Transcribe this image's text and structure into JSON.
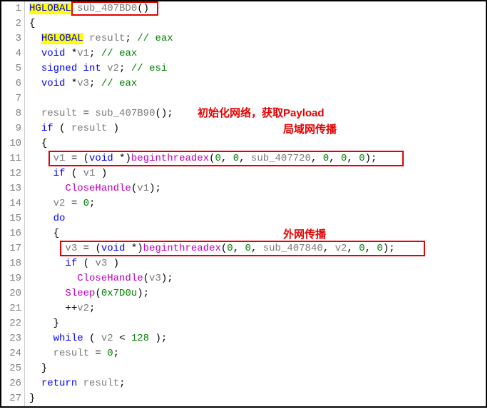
{
  "line_numbers": [
    "1",
    "2",
    "3",
    "4",
    "5",
    "6",
    "7",
    "8",
    "9",
    "10",
    "11",
    "12",
    "13",
    "14",
    "15",
    "16",
    "17",
    "18",
    "19",
    "20",
    "21",
    "22",
    "23",
    "24",
    "25",
    "26",
    "27"
  ],
  "code": {
    "l1": {
      "type": "HGLOBAL",
      "func": "sub_407BD0",
      "paren": "()"
    },
    "l2": "{",
    "l3": {
      "type": "HGLOBAL",
      "var": "result",
      "comment": "// eax"
    },
    "l4": {
      "type": "void",
      "ptr": "*",
      "var": "v1",
      "comment": "// eax"
    },
    "l5": {
      "type": "signed int",
      "var": "v2",
      "comment": "// esi"
    },
    "l6": {
      "type": "void",
      "ptr": "*",
      "var": "v3",
      "comment": "// eax"
    },
    "l8": {
      "var": "result",
      "func": "sub_407B90",
      "paren": "()"
    },
    "l9": {
      "kw": "if",
      "var": "result"
    },
    "l10": "{",
    "l11": {
      "var": "v1",
      "cast_kw": "void",
      "func": "beginthreadex",
      "args_pre": "(",
      "n0": "0",
      "n1": "0",
      "sub": "sub_407720",
      "n2": "0",
      "n3": "0",
      "n4": "0",
      "args_post": ");"
    },
    "l12": {
      "kw": "if",
      "var": "v1"
    },
    "l13": {
      "func": "CloseHandle",
      "var": "v1"
    },
    "l14": {
      "var": "v2",
      "val": "0"
    },
    "l15": {
      "kw": "do"
    },
    "l16": "{",
    "l17": {
      "var": "v3",
      "cast_kw": "void",
      "func": "beginthreadex",
      "n0": "0",
      "n1": "0",
      "sub": "sub_407840",
      "arg": "v2",
      "n3": "0",
      "n4": "0"
    },
    "l18": {
      "kw": "if",
      "var": "v3"
    },
    "l19": {
      "func": "CloseHandle",
      "var": "v3"
    },
    "l20": {
      "func": "Sleep",
      "val": "0x7D0u"
    },
    "l21": {
      "op": "++",
      "var": "v2"
    },
    "l22": "}",
    "l23": {
      "kw": "while",
      "var": "v2",
      "op": "<",
      "val": "128"
    },
    "l24": {
      "var": "result",
      "val": "0"
    },
    "l25": "}",
    "l26": {
      "kw": "return",
      "var": "result"
    },
    "l27": "}"
  },
  "annotations": {
    "a1": "初始化网络，获取Payload",
    "a2": "局域网传播",
    "a3": "外网传播"
  }
}
